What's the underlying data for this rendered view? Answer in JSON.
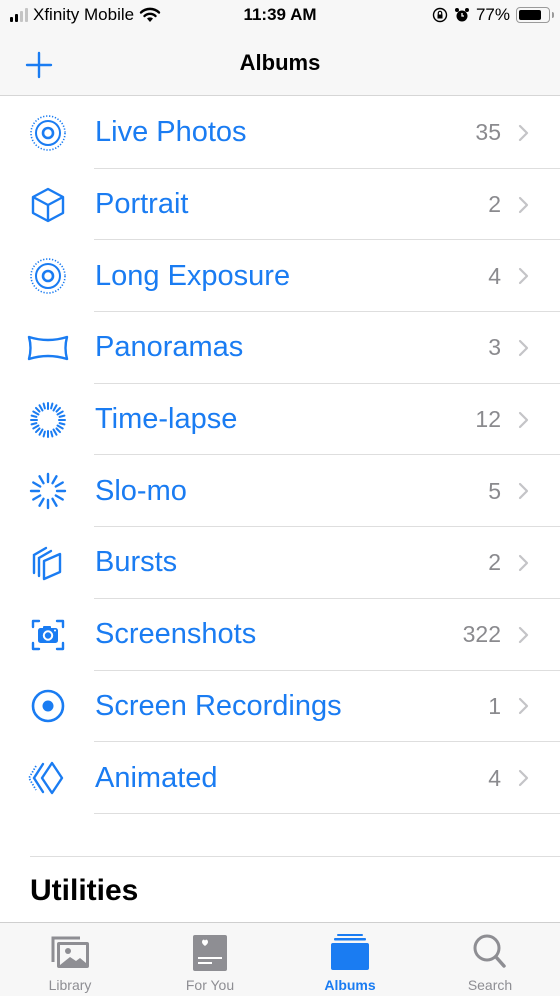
{
  "status_bar": {
    "carrier": "Xfinity Mobile",
    "time": "11:39 AM",
    "battery_percent_label": "77%",
    "battery_level": 0.77,
    "signal_bars_active": 2,
    "signal_bars_total": 4
  },
  "nav": {
    "title": "Albums",
    "add_icon": "plus-icon"
  },
  "colors": {
    "accent": "#1a7cf2",
    "count_gray": "#8a8a8e",
    "chevron_gray": "#c4c4c7",
    "tab_inactive": "#8e8e93"
  },
  "media_types": [
    {
      "label": "Live Photos",
      "count": "35",
      "icon": "live-photos-icon"
    },
    {
      "label": "Portrait",
      "count": "2",
      "icon": "portrait-cube-icon"
    },
    {
      "label": "Long Exposure",
      "count": "4",
      "icon": "long-exposure-icon"
    },
    {
      "label": "Panoramas",
      "count": "3",
      "icon": "panorama-icon"
    },
    {
      "label": "Time-lapse",
      "count": "12",
      "icon": "time-lapse-icon"
    },
    {
      "label": "Slo-mo",
      "count": "5",
      "icon": "slo-mo-icon"
    },
    {
      "label": "Bursts",
      "count": "2",
      "icon": "bursts-icon"
    },
    {
      "label": "Screenshots",
      "count": "322",
      "icon": "screenshot-icon"
    },
    {
      "label": "Screen Recordings",
      "count": "1",
      "icon": "screen-recording-icon"
    },
    {
      "label": "Animated",
      "count": "4",
      "icon": "animated-icon"
    }
  ],
  "sections": {
    "utilities_title": "Utilities"
  },
  "tab_bar": {
    "tabs": [
      {
        "label": "Library",
        "icon": "library-icon",
        "active": false
      },
      {
        "label": "For You",
        "icon": "for-you-icon",
        "active": false
      },
      {
        "label": "Albums",
        "icon": "albums-icon",
        "active": true
      },
      {
        "label": "Search",
        "icon": "search-icon",
        "active": false
      }
    ]
  }
}
